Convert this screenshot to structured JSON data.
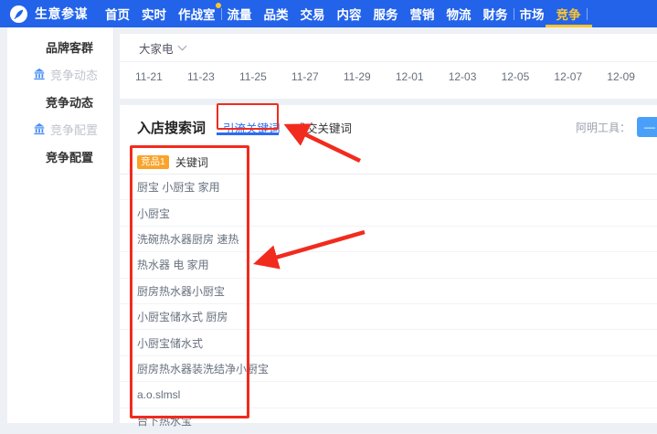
{
  "nav": {
    "brand": "生意参谋",
    "group1": [
      {
        "label": "首页"
      },
      {
        "label": "实时"
      },
      {
        "label": "作战室",
        "dot": true
      }
    ],
    "group2": [
      {
        "label": "流量"
      },
      {
        "label": "品类"
      },
      {
        "label": "交易"
      },
      {
        "label": "内容"
      },
      {
        "label": "服务"
      },
      {
        "label": "营销"
      },
      {
        "label": "物流"
      },
      {
        "label": "财务"
      }
    ],
    "group3": [
      {
        "label": "市场"
      },
      {
        "label": "竞争",
        "active": true
      }
    ]
  },
  "sidebar": {
    "items": [
      {
        "label": "品牌客群",
        "icon": false,
        "muted": false
      },
      {
        "label": "竞争动态",
        "icon": true,
        "muted": true
      },
      {
        "label": "竞争动态",
        "icon": false,
        "muted": false
      },
      {
        "label": "竞争配置",
        "icon": true,
        "muted": true
      },
      {
        "label": "竞争配置",
        "icon": false,
        "muted": false
      }
    ]
  },
  "filter": {
    "category": "大家电"
  },
  "axis": {
    "dates": [
      "11-21",
      "11-23",
      "11-25",
      "11-27",
      "11-29",
      "12-01",
      "12-03",
      "12-05",
      "12-07",
      "12-09"
    ]
  },
  "section": {
    "title": "入店搜索词",
    "tabs": [
      {
        "label": "引流关键词",
        "active": true
      },
      {
        "label": "成交关键词",
        "active": false
      }
    ],
    "tool_label": "阿明工具：",
    "tool_button_glyph": "—"
  },
  "keyword_table": {
    "competitor_badge": "竞品1",
    "header": "关键词",
    "rows": [
      "厨宝 小厨宝 家用",
      "小厨宝",
      "洗碗热水器厨房 速热",
      "热水器 电 家用",
      "厨房热水器小厨宝",
      "小厨宝储水式 厨房",
      "小厨宝储水式",
      "厨房热水器装洗结净小厨宝",
      "a.o.slmsl",
      "台下热水宝"
    ]
  },
  "colors": {
    "nav_bg": "#2263ea",
    "nav_active": "#fbc531",
    "tab_active": "#2e6bf0",
    "annotation_red": "#f12b1e",
    "badge_orange": "#f9a32a",
    "tool_button_blue": "#4aa0f8"
  }
}
